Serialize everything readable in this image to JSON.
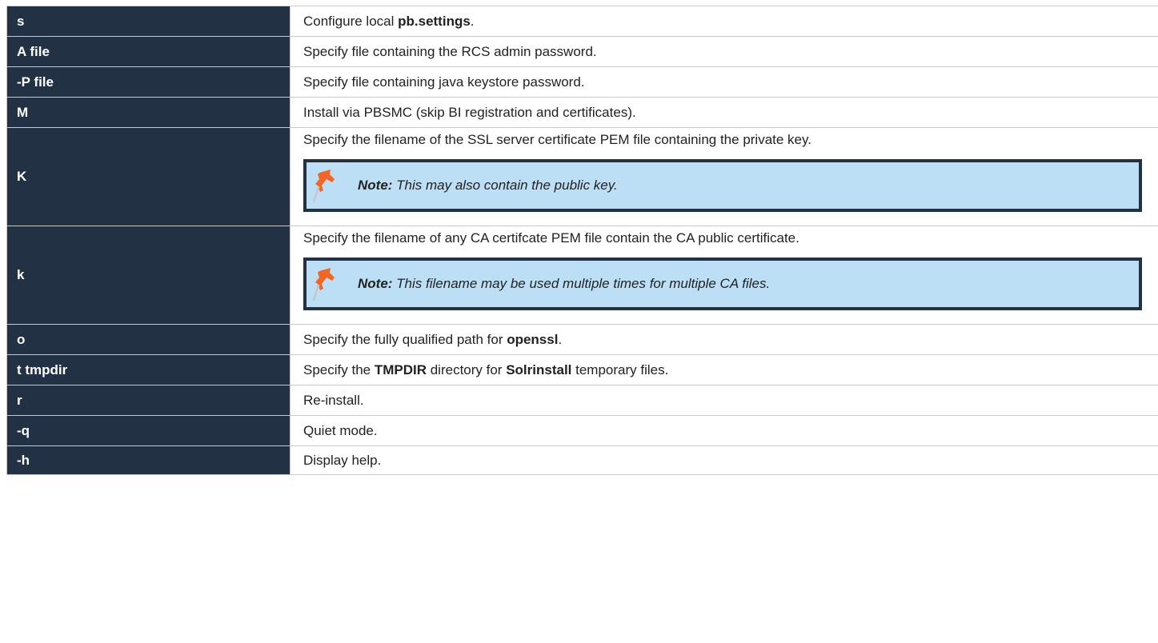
{
  "options": [
    {
      "flag": "s",
      "desc_pre": "Configure local ",
      "desc_bold": "pb.settings",
      "desc_post": "."
    },
    {
      "flag": "A file",
      "desc": "Specify file containing the RCS admin password."
    },
    {
      "flag": "-P file",
      "desc": "Specify file containing java keystore password."
    },
    {
      "flag": "M",
      "desc": "Install via PBSMC (skip BI registration and certificates)."
    },
    {
      "flag": "K",
      "desc": "Specify the filename of the SSL server certificate PEM file containing the private key.",
      "note_label": "Note:",
      "note_text": " This may also contain the public key."
    },
    {
      "flag": "k",
      "desc": "Specify the filename of any CA certifcate PEM file contain the CA public certificate.",
      "note_label": "Note:",
      "note_text": " This filename may be used multiple times for multiple CA files."
    },
    {
      "flag": "o",
      "desc_pre": "Specify the fully qualified path for ",
      "desc_bold": "openssl",
      "desc_post": "."
    },
    {
      "flag": "t tmpdir",
      "desc_pre": "Specify the ",
      "desc_bold": "TMPDIR",
      "desc_mid": " directory for ",
      "desc_bold2": "Solrinstall",
      "desc_post": " temporary files."
    },
    {
      "flag": "r",
      "desc": "Re-install."
    },
    {
      "flag": "-q",
      "desc": "Quiet mode."
    },
    {
      "flag": "-h",
      "desc": "Display help."
    }
  ],
  "colors": {
    "header_cell": "#223244",
    "note_background": "#bcdff5",
    "note_border": "#223244",
    "pin_icon": "#f26522"
  },
  "icons": {
    "note": "pushpin-icon"
  }
}
